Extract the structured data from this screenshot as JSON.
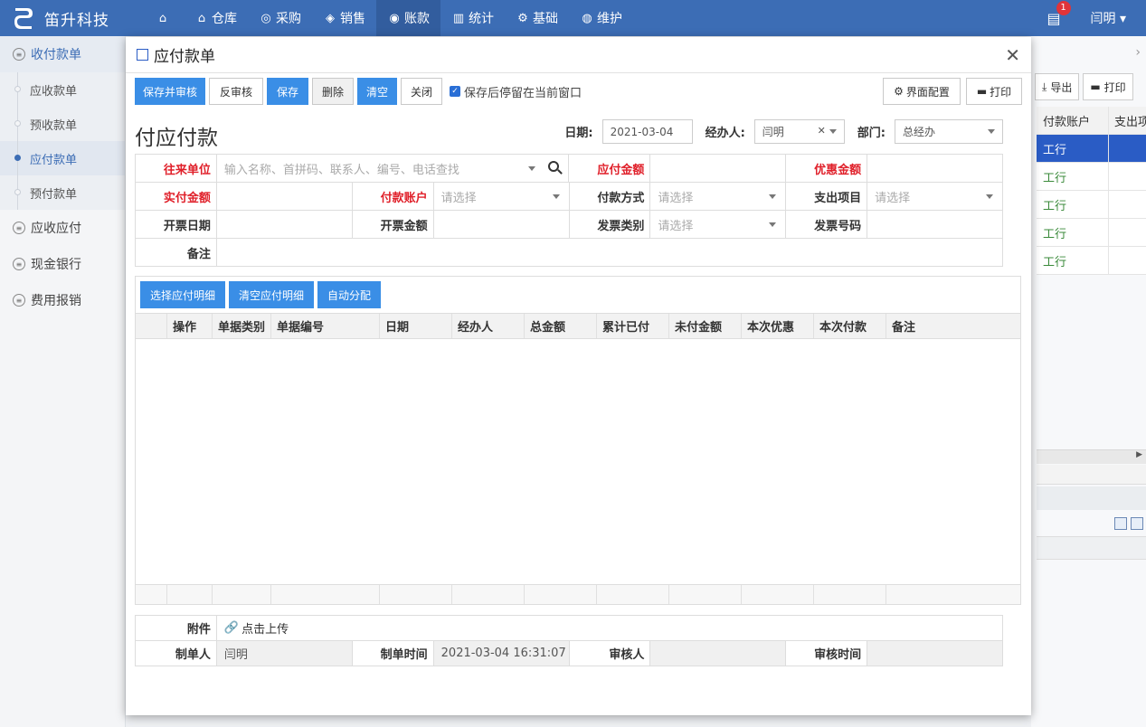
{
  "app": {
    "brand": "笛升科技",
    "user": "闫明",
    "notification_count": "1"
  },
  "nav": [
    {
      "label": "",
      "icon": "home-icon"
    },
    {
      "label": "仓库",
      "icon": "warehouse-icon"
    },
    {
      "label": "采购",
      "icon": "purchase-icon"
    },
    {
      "label": "销售",
      "icon": "sales-icon"
    },
    {
      "label": "账款",
      "icon": "accounts-icon"
    },
    {
      "label": "统计",
      "icon": "stats-icon"
    },
    {
      "label": "基础",
      "icon": "gear-icon"
    },
    {
      "label": "维护",
      "icon": "maintain-icon"
    }
  ],
  "sidebar": {
    "groups": [
      {
        "label": "收付款单"
      },
      {
        "label": "应收应付"
      },
      {
        "label": "现金银行"
      },
      {
        "label": "费用报销"
      }
    ],
    "subitems": [
      {
        "label": "应收款单"
      },
      {
        "label": "预收款单"
      },
      {
        "label": "应付款单"
      },
      {
        "label": "预付款单"
      }
    ]
  },
  "background": {
    "export": "导出",
    "print": "打印",
    "col1": "付款账户",
    "col2": "支出项",
    "rows": [
      "工行",
      "工行",
      "工行",
      "工行",
      "工行"
    ]
  },
  "modal": {
    "title": "应付款单",
    "toolbar": {
      "save_audit": "保存并审核",
      "unaudit": "反审核",
      "save": "保存",
      "delete": "删除",
      "clear": "清空",
      "close": "关闭",
      "stay_checkbox": "保存后停留在当前窗口",
      "ui_config": "界面配置",
      "print": "打印"
    },
    "form_title": "付应付款",
    "date_label": "日期:",
    "date_value": "2021-03-04",
    "handler_label": "经办人:",
    "handler_value": "闫明",
    "dept_label": "部门:",
    "dept_value": "总经办",
    "fields": {
      "partner_label": "往来单位",
      "partner_placeholder": "输入名称、首拼码、联系人、编号、电话查找",
      "payable_label": "应付金额",
      "discount_label": "优惠金额",
      "actual_label": "实付金额",
      "account_label": "付款账户",
      "account_placeholder": "请选择",
      "method_label": "付款方式",
      "method_placeholder": "请选择",
      "expense_label": "支出项目",
      "expense_placeholder": "请选择",
      "invoice_date_label": "开票日期",
      "invoice_amount_label": "开票金额",
      "invoice_type_label": "发票类别",
      "invoice_type_placeholder": "请选择",
      "invoice_no_label": "发票号码",
      "remark_label": "备注"
    },
    "detail": {
      "select_btn": "选择应付明细",
      "clear_btn": "清空应付明细",
      "auto_btn": "自动分配",
      "columns": [
        "",
        "操作",
        "单据类别",
        "单据编号",
        "日期",
        "经办人",
        "总金额",
        "累计已付",
        "未付金额",
        "本次优惠",
        "本次付款",
        "备注"
      ]
    },
    "footer": {
      "attach_label": "附件",
      "upload": "点击上传",
      "maker_label": "制单人",
      "maker_value": "闫明",
      "make_time_label": "制单时间",
      "make_time_value": "2021-03-04 16:31:07",
      "auditor_label": "审核人",
      "audit_time_label": "审核时间"
    }
  },
  "colors": {
    "topbar": "#3c6db5",
    "primary_button": "#3a8ee6",
    "required_label": "#e0202a",
    "selected_row": "#2a5cc5"
  }
}
